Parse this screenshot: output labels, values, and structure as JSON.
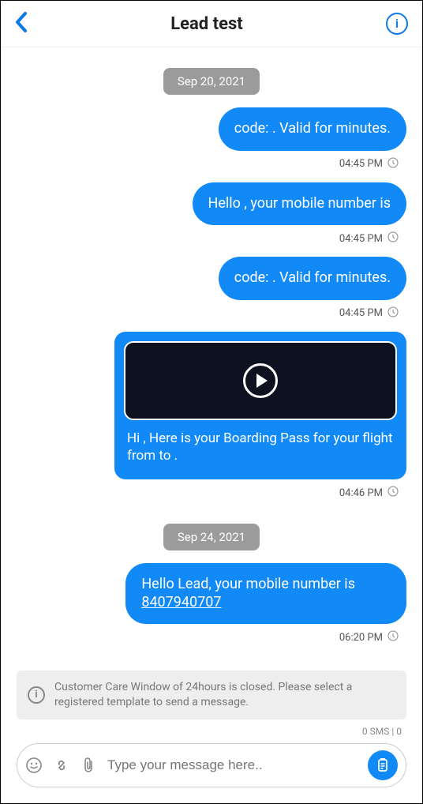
{
  "header": {
    "title": "Lead test"
  },
  "dates": {
    "d1": "Sep 20, 2021",
    "d2": "Sep 24, 2021"
  },
  "messages": {
    "m1": {
      "text": "code: . Valid for  minutes.",
      "time": "04:45 PM"
    },
    "m2": {
      "text": "Hello , your mobile number is",
      "time": "04:45 PM"
    },
    "m3": {
      "text": "code: . Valid for  minutes.",
      "time": "04:45 PM"
    },
    "m4": {
      "text": "Hi   , Here is your Boarding Pass for your flight   from   to   .",
      "time": "04:46 PM"
    },
    "m5": {
      "text_prefix": "Hello Lead, your mobile number is ",
      "phone": "8407940707",
      "time": "06:20 PM"
    }
  },
  "footer": {
    "notice": "Customer Care Window of 24hours is closed. Please select a registered template to send a message.",
    "counter": "0 SMS | 0",
    "placeholder": "Type your message here.."
  }
}
